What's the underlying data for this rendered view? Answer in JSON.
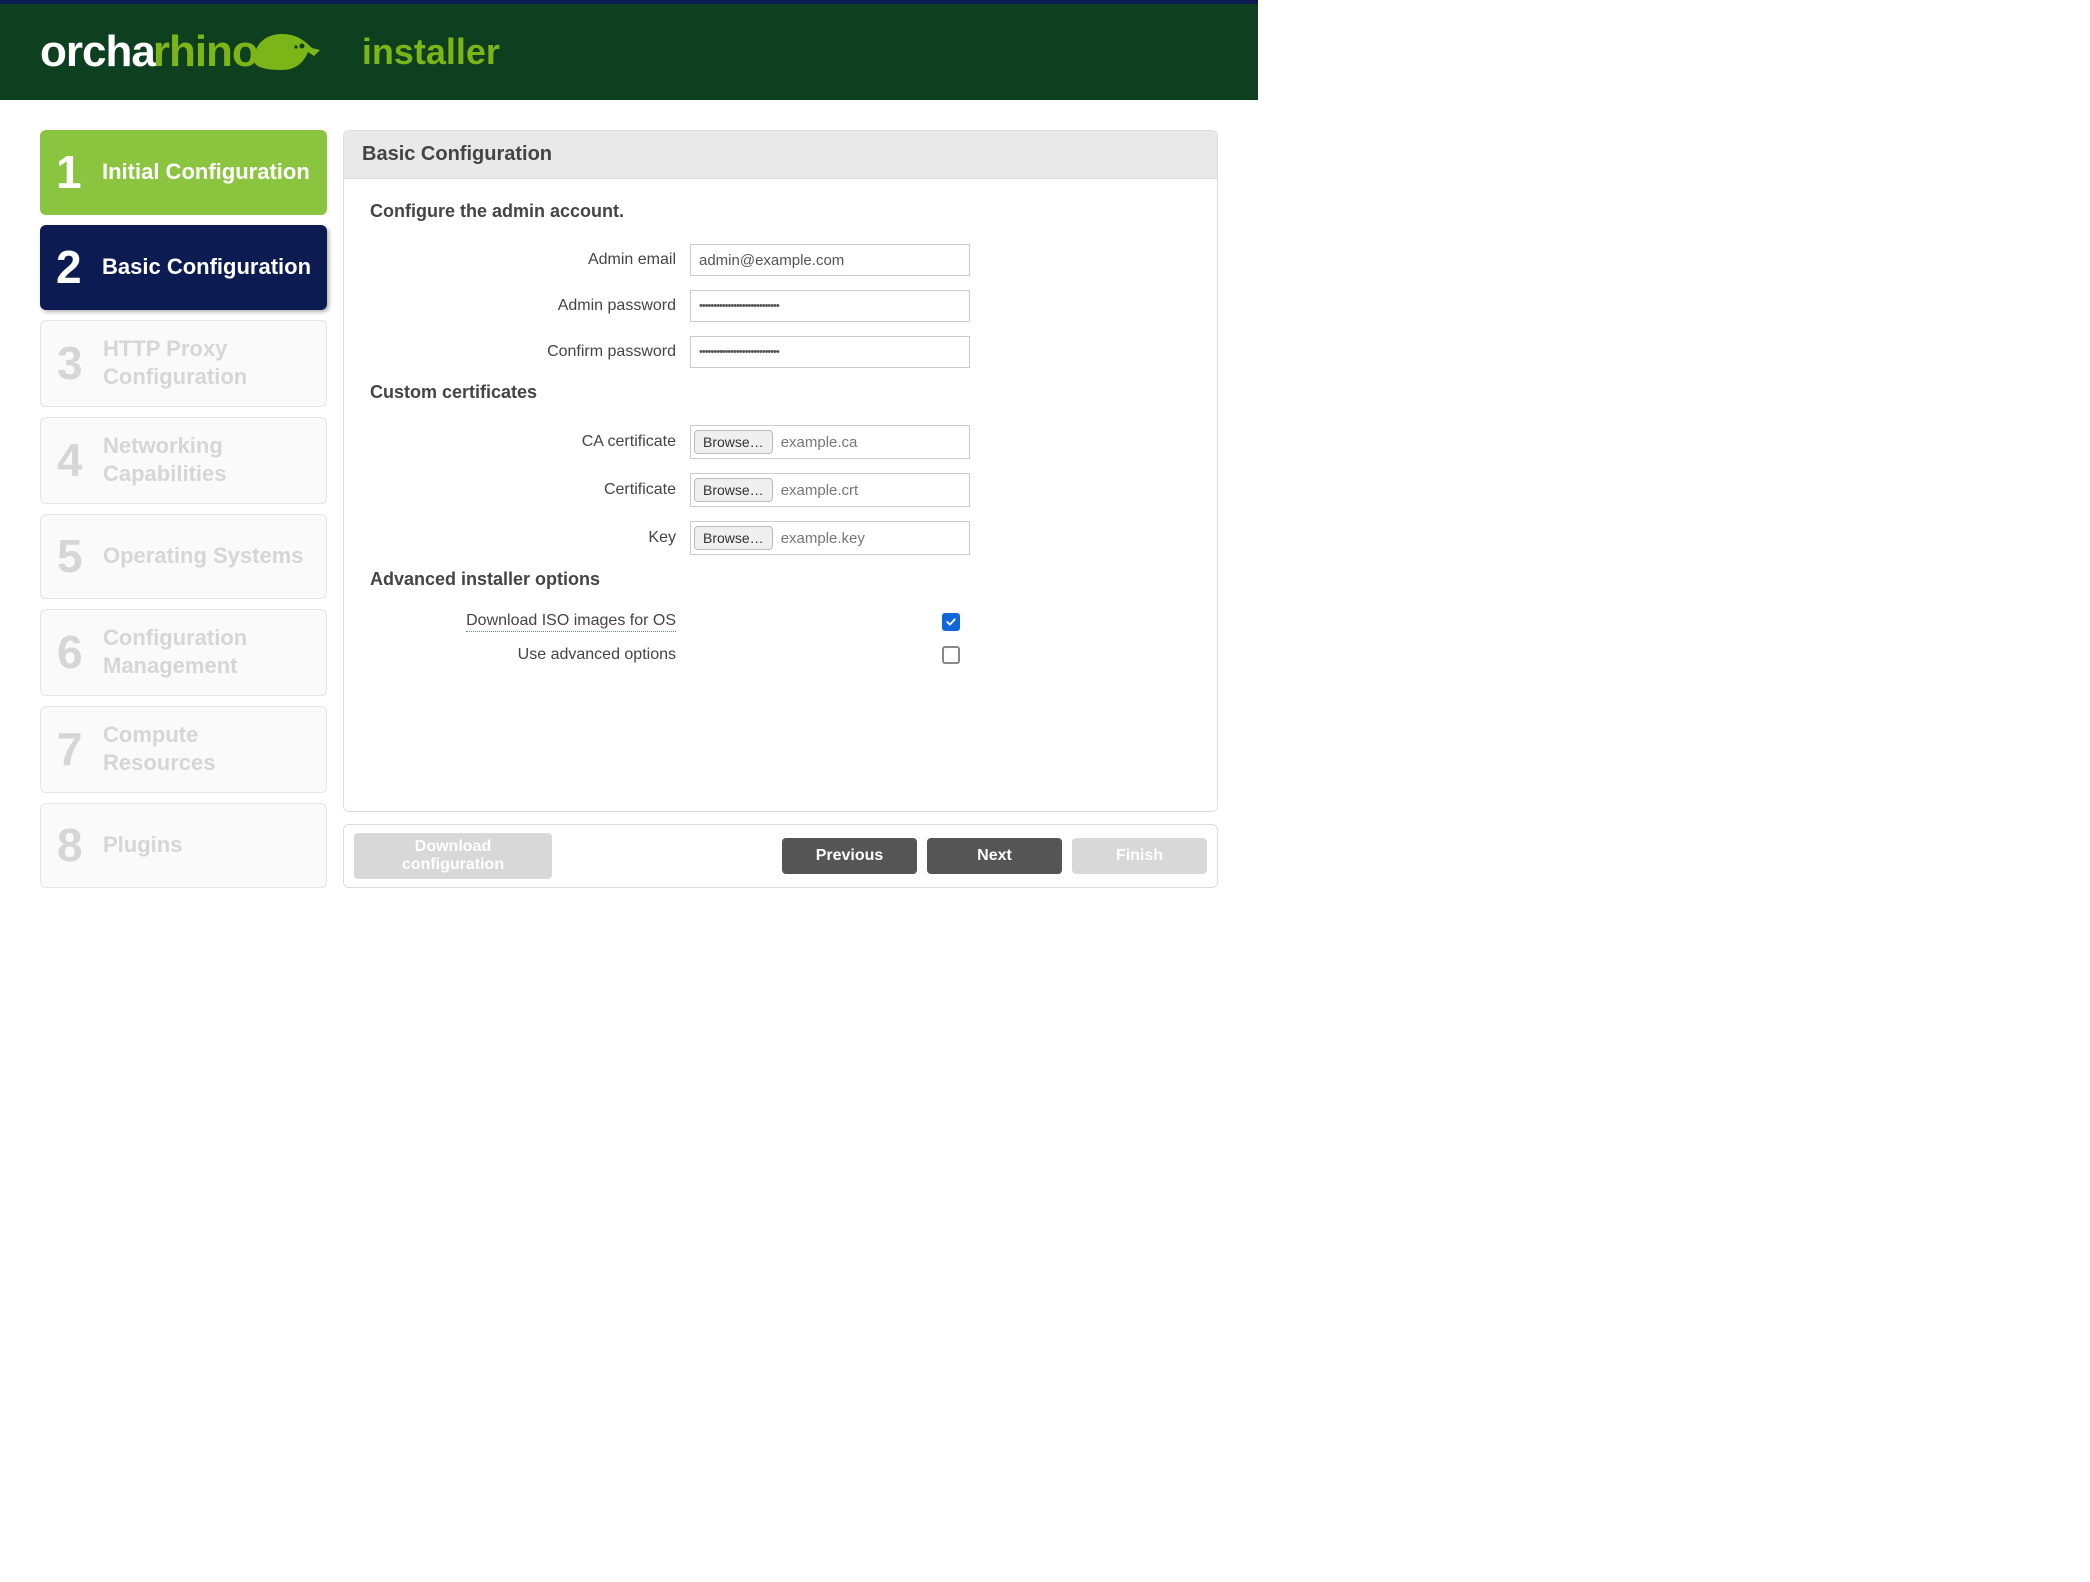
{
  "header": {
    "brand_part1": "orcha",
    "brand_part2": "rhino",
    "installer_label": "installer"
  },
  "sidebar": {
    "steps": [
      {
        "num": "1",
        "label": "Initial Configuration",
        "state": "completed"
      },
      {
        "num": "2",
        "label": "Basic Configuration",
        "state": "active"
      },
      {
        "num": "3",
        "label": "HTTP Proxy Configuration",
        "state": "future"
      },
      {
        "num": "4",
        "label": "Networking Capabilities",
        "state": "future"
      },
      {
        "num": "5",
        "label": "Operating Systems",
        "state": "future"
      },
      {
        "num": "6",
        "label": "Configuration Management",
        "state": "future"
      },
      {
        "num": "7",
        "label": "Compute Resources",
        "state": "future"
      },
      {
        "num": "8",
        "label": "Plugins",
        "state": "future"
      }
    ]
  },
  "panel": {
    "title": "Basic Configuration",
    "admin_section_title": "Configure the admin account.",
    "cert_section_title": "Custom certificates",
    "advanced_section_title": "Advanced installer options",
    "labels": {
      "admin_email": "Admin email",
      "admin_password": "Admin password",
      "confirm_password": "Confirm password",
      "ca_certificate": "CA certificate",
      "certificate": "Certificate",
      "key": "Key",
      "download_iso": "Download ISO images for OS",
      "use_advanced": "Use advanced options"
    },
    "values": {
      "admin_email": "admin@example.com",
      "admin_password": "••••••••••••••••••••••••••••",
      "confirm_password": "••••••••••••••••••••••••••••",
      "ca_certificate_file": "example.ca",
      "certificate_file": "example.crt",
      "key_file": "example.key",
      "download_iso_checked": true,
      "use_advanced_checked": false
    },
    "browse_label": "Browse…"
  },
  "footer": {
    "download_line1": "Download",
    "download_line2": "configuration",
    "previous": "Previous",
    "next": "Next",
    "finish": "Finish"
  }
}
